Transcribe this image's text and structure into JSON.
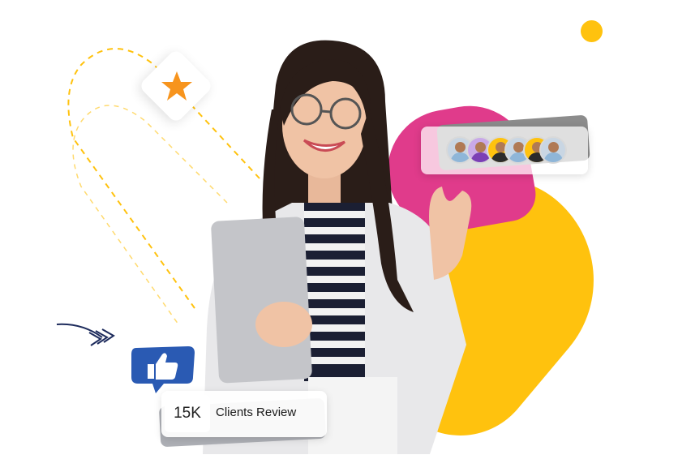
{
  "hero": {
    "stats": {
      "count": "15K",
      "label": "Clients Review"
    },
    "icons": {
      "star": "star-icon",
      "like": "thumbs-up-icon",
      "arrow": "chevrons-right-icon"
    },
    "avatars": [
      {
        "name": "avatar-1",
        "color": "#8fb6d8"
      },
      {
        "name": "avatar-2",
        "color": "#7b3fb5"
      },
      {
        "name": "avatar-3",
        "color": "#2b2b2b"
      },
      {
        "name": "avatar-4",
        "color": "#8fb6d8"
      },
      {
        "name": "avatar-5",
        "color": "#2b2b2b"
      },
      {
        "name": "avatar-6",
        "color": "#8fb6d8"
      }
    ],
    "colors": {
      "yellow": "#FFC20E",
      "pink": "#E03B8B",
      "navy": "#1d2b5c",
      "like_blue": "#2a5ab3",
      "star_orange": "#F7941D"
    }
  }
}
